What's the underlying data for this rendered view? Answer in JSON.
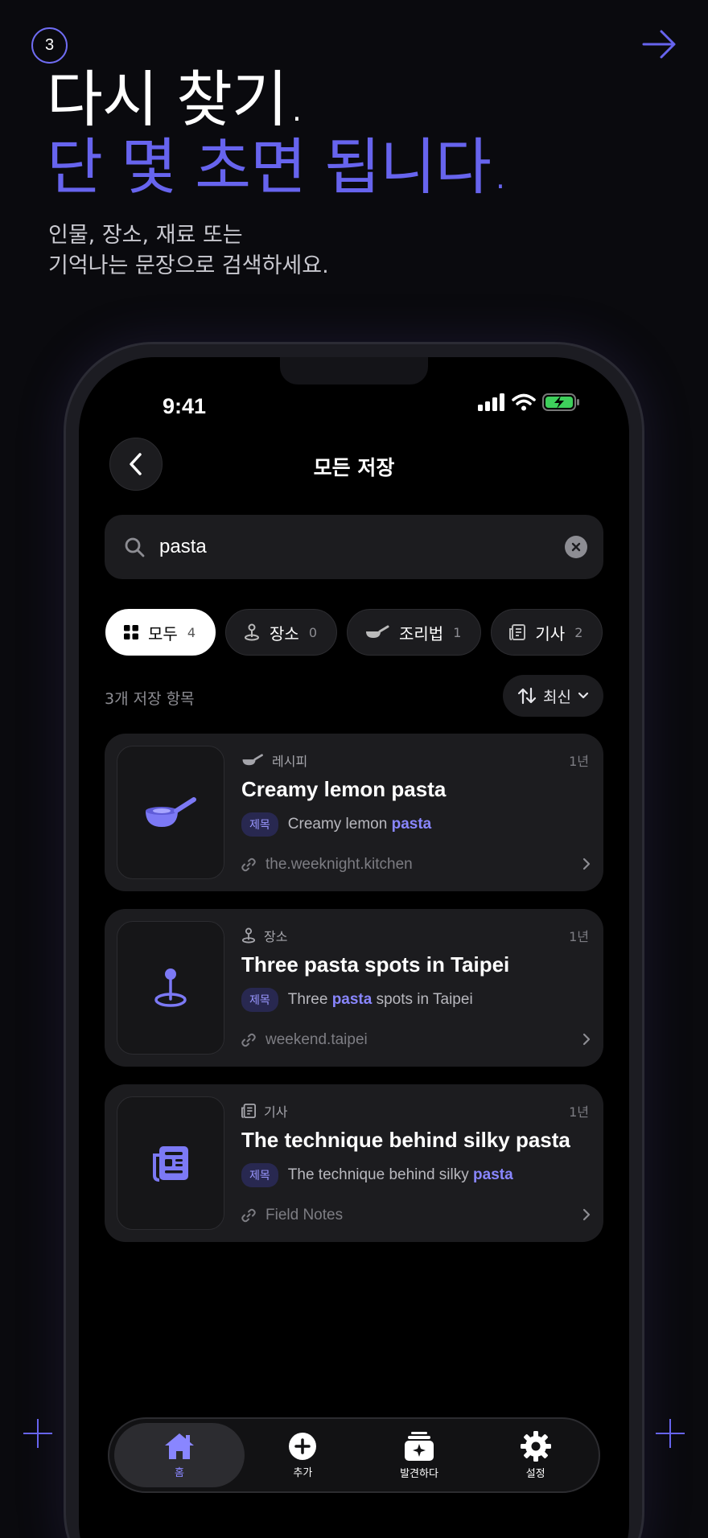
{
  "step_number": "3",
  "headline": {
    "line1": "다시 찾기.",
    "line2": "단 몇 초면 됩니다."
  },
  "subcopy": {
    "line1": "인물, 장소, 재료 또는",
    "line2": "기억나는 문장으로 검색하세요."
  },
  "colors": {
    "accent": "#6764ee",
    "highlight": "#8986ff",
    "card_bg": "#1c1c1f",
    "background": "#0a0a0e"
  },
  "status_bar": {
    "time": "9:41"
  },
  "screen": {
    "title": "모든 저장"
  },
  "search": {
    "value": "pasta"
  },
  "filters": [
    {
      "label": "모두",
      "count": "4",
      "icon": "grid-icon",
      "selected": true
    },
    {
      "label": "장소",
      "count": "0",
      "icon": "pin-icon",
      "selected": false
    },
    {
      "label": "조리법",
      "count": "1",
      "icon": "pan-icon",
      "selected": false
    },
    {
      "label": "기사",
      "count": "2",
      "icon": "article-icon",
      "selected": false
    }
  ],
  "results": {
    "count_label": "3개 저장 항목",
    "sort_label": "최신"
  },
  "cards": [
    {
      "category": "레시피",
      "category_icon": "pan-icon",
      "age": "1년",
      "title": "Creamy lemon pasta",
      "match_tag": "제목",
      "match_before": "Creamy lemon ",
      "match_highlight": "pasta",
      "match_after": "",
      "source": "the.weeknight.kitchen"
    },
    {
      "category": "장소",
      "category_icon": "pin-icon",
      "age": "1년",
      "title": "Three pasta spots in Taipei",
      "match_tag": "제목",
      "match_before": "Three ",
      "match_highlight": "pasta",
      "match_after": " spots in Taipei",
      "source": "weekend.taipei"
    },
    {
      "category": "기사",
      "category_icon": "article-icon",
      "age": "1년",
      "title": "The technique behind silky pasta",
      "match_tag": "제목",
      "match_before": "The technique behind silky ",
      "match_highlight": "pasta",
      "match_after": "",
      "source": "Field Notes"
    }
  ],
  "tabbar": [
    {
      "label": "홈",
      "icon": "home-icon",
      "active": true
    },
    {
      "label": "추가",
      "icon": "add-icon",
      "active": false
    },
    {
      "label": "발견하다",
      "icon": "discover-icon",
      "active": false
    },
    {
      "label": "설정",
      "icon": "settings-icon",
      "active": false
    }
  ]
}
